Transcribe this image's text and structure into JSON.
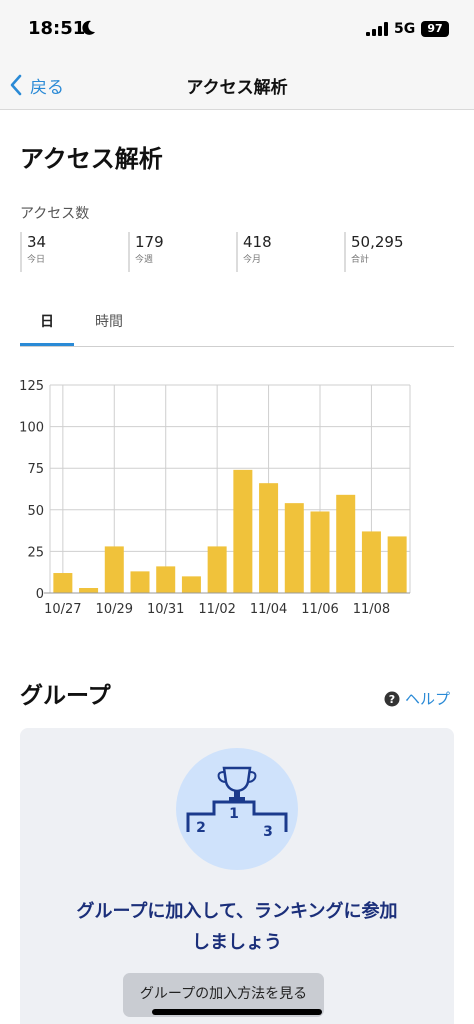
{
  "status_bar": {
    "time": "18:51",
    "network": "5G",
    "battery": "97"
  },
  "nav": {
    "back_label": "戻る",
    "title": "アクセス解析"
  },
  "page": {
    "title": "アクセス解析",
    "access_label": "アクセス数"
  },
  "stats": [
    {
      "value": "34",
      "label": "今日"
    },
    {
      "value": "179",
      "label": "今週"
    },
    {
      "value": "418",
      "label": "今月"
    },
    {
      "value": "50,295",
      "label": "合計"
    }
  ],
  "tabs": [
    {
      "label": "日",
      "active": true
    },
    {
      "label": "時間",
      "active": false
    }
  ],
  "chart_data": {
    "type": "bar",
    "categories": [
      "10/27",
      "10/28",
      "10/29",
      "10/30",
      "10/31",
      "11/01",
      "11/02",
      "11/03",
      "11/04",
      "11/05",
      "11/06",
      "11/07",
      "11/08",
      "11/09"
    ],
    "x_tick_labels": [
      "10/27",
      "10/29",
      "10/31",
      "11/02",
      "11/04",
      "11/06",
      "11/08"
    ],
    "values": [
      12,
      3,
      28,
      13,
      16,
      10,
      28,
      74,
      66,
      54,
      49,
      59,
      37,
      34
    ],
    "y_ticks": [
      "0",
      "25",
      "50",
      "75",
      "100",
      "125"
    ],
    "ylim": [
      0,
      125
    ],
    "grid": true,
    "bar_color": "#f0c23b"
  },
  "group": {
    "title": "グループ",
    "help_label": "ヘルプ",
    "cta_line1": "グループに加入して、ランキングに参加",
    "cta_line2": "しましょう",
    "button_label": "グループの加入方法を見る",
    "podium_numbers": [
      "1",
      "2",
      "3"
    ]
  },
  "colors": {
    "accent": "#2a8ad6",
    "bar": "#f0c23b",
    "cta_text": "#1b2f7a",
    "trophy_circle": "#cfe2fb"
  }
}
